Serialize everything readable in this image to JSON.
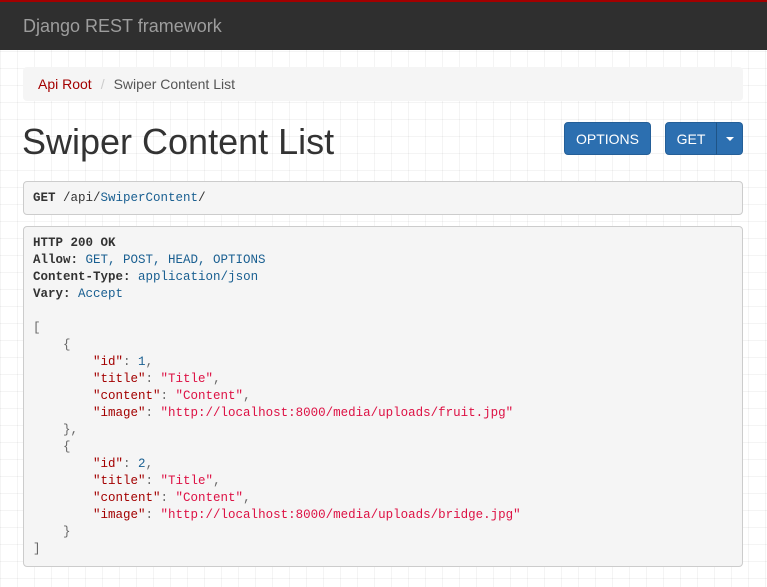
{
  "navbar": {
    "brand": "Django REST framework"
  },
  "breadcrumb": {
    "root": "Api Root",
    "separator": "/",
    "current": "Swiper Content List"
  },
  "page": {
    "title": "Swiper Content List"
  },
  "buttons": {
    "options": "OPTIONS",
    "get": "GET"
  },
  "request": {
    "method": "GET",
    "path_prefix": "/api/",
    "path_link": "SwiperContent",
    "path_suffix": "/"
  },
  "response": {
    "status": "HTTP 200 OK",
    "headers": [
      {
        "name": "Allow:",
        "value": "GET, POST, HEAD, OPTIONS"
      },
      {
        "name": "Content-Type:",
        "value": "application/json"
      },
      {
        "name": "Vary:",
        "value": "Accept"
      }
    ],
    "items": [
      {
        "id_key": "\"id\"",
        "id": "1",
        "title_key": "\"title\"",
        "title": "\"Title\"",
        "content_key": "\"content\"",
        "content": "\"Content\"",
        "image_key": "\"image\"",
        "image": "\"http://localhost:8000/media/uploads/fruit.jpg\""
      },
      {
        "id_key": "\"id\"",
        "id": "2",
        "title_key": "\"title\"",
        "title": "\"Title\"",
        "content_key": "\"content\"",
        "content": "\"Content\"",
        "image_key": "\"image\"",
        "image": "\"http://localhost:8000/media/uploads/bridge.jpg\""
      }
    ]
  },
  "colors": {
    "navbar_bg": "#2f2f2f",
    "accent": "#a30000",
    "button_bg": "#2c6fb0",
    "string": "#dd1144",
    "literal": "#195f91"
  }
}
